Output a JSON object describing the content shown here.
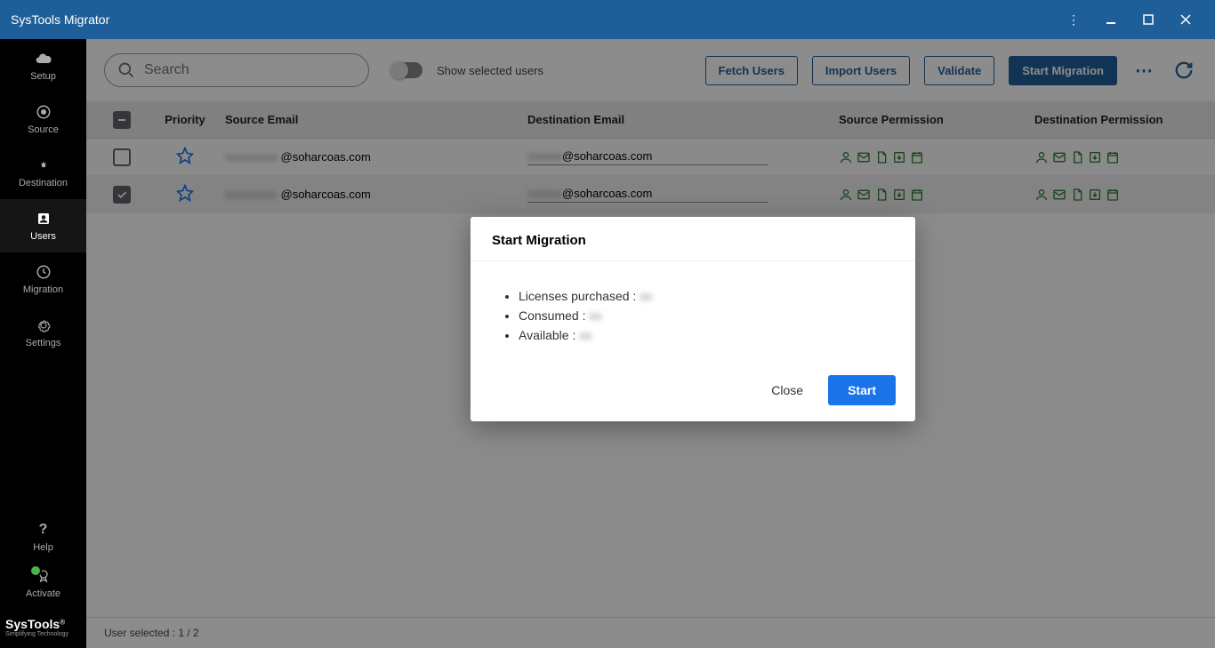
{
  "titlebar": {
    "title": "SysTools Migrator"
  },
  "sidebar": {
    "items": [
      {
        "label": "Setup"
      },
      {
        "label": "Source"
      },
      {
        "label": "Destination"
      },
      {
        "label": "Users"
      },
      {
        "label": "Migration"
      },
      {
        "label": "Settings"
      }
    ],
    "help_label": "Help",
    "activate_label": "Activate",
    "brand_name": "SysTools",
    "brand_tag": "Simplifying Technology"
  },
  "toolbar": {
    "search_placeholder": "Search",
    "toggle_label": "Show selected users",
    "fetch_label": "Fetch Users",
    "import_label": "Import Users",
    "validate_label": "Validate",
    "start_label": "Start Migration"
  },
  "table": {
    "headers": {
      "priority": "Priority",
      "source": "Source Email",
      "destination": "Destination Email",
      "src_perm": "Source Permission",
      "dst_perm": "Destination Permission"
    },
    "rows": [
      {
        "checked": false,
        "src_hidden": "xxxxxxxxx",
        "src_domain": "@soharcoas.com",
        "dst_hidden": "xxxxxx",
        "dst_domain": "@soharcoas.com"
      },
      {
        "checked": true,
        "src_hidden": "xxxxxxxxx",
        "src_domain": "@soharcoas.com",
        "dst_hidden": "xxxxxx",
        "dst_domain": "@soharcoas.com"
      }
    ]
  },
  "statusbar": {
    "text": "User selected : 1 / 2"
  },
  "modal": {
    "title": "Start Migration",
    "licenses_label": "Licenses purchased : ",
    "licenses_value": "xx",
    "consumed_label": "Consumed : ",
    "consumed_value": "xx",
    "available_label": "Available : ",
    "available_value": "xx",
    "close_label": "Close",
    "start_label": "Start"
  }
}
